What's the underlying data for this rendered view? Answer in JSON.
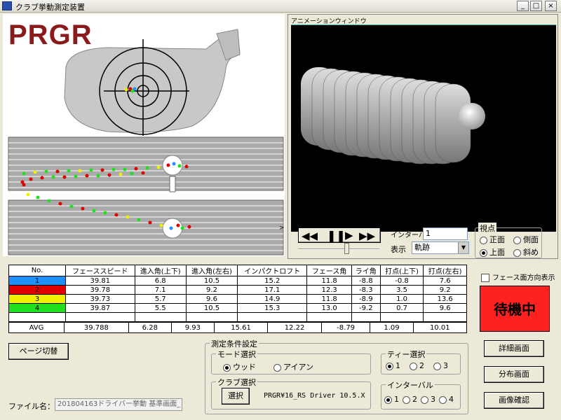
{
  "window": {
    "title": "クラブ挙動測定装置",
    "buttons": [
      "_",
      "□",
      "×"
    ]
  },
  "logo": {
    "text_a": "PR",
    "text_b": "GR"
  },
  "animation_window": {
    "title": "アニメーションウィンドウ"
  },
  "playback": {
    "interval_label": "インターバル",
    "interval_value": "1",
    "display_label": "表示",
    "display_value": "軌跡"
  },
  "viewpoint": {
    "label": "視点",
    "options": [
      {
        "label": "正面",
        "selected": false
      },
      {
        "label": "側面",
        "selected": false
      },
      {
        "label": "上面",
        "selected": true
      },
      {
        "label": "斜め",
        "selected": false
      }
    ]
  },
  "face_direction": {
    "label": "フェース面方向表示"
  },
  "table": {
    "headers": [
      "No.",
      "フェーススピード",
      "進入角(上下)",
      "進入角(左右)",
      "インパクトロフト",
      "フェース角",
      "ライ角",
      "打点(上下)",
      "打点(左右)"
    ],
    "rows": [
      {
        "no": "1",
        "color": "#1e90ff",
        "values": [
          "39.81",
          "6.8",
          "10.5",
          "15.2",
          "11.8",
          "-8.8",
          "-0.8",
          "7.6"
        ]
      },
      {
        "no": "2",
        "color": "#e00000",
        "values": [
          "39.78",
          "7.1",
          "9.2",
          "17.1",
          "12.3",
          "-8.3",
          "3.5",
          "9.2"
        ]
      },
      {
        "no": "3",
        "color": "#f0f000",
        "values": [
          "39.73",
          "5.7",
          "9.6",
          "14.9",
          "11.8",
          "-8.9",
          "1.0",
          "13.6"
        ]
      },
      {
        "no": "4",
        "color": "#20e020",
        "values": [
          "39.87",
          "5.5",
          "10.5",
          "15.3",
          "13.0",
          "-9.2",
          "0.7",
          "9.6"
        ]
      }
    ],
    "avg_label": "AVG",
    "avg_values": [
      "39.788",
      "6.28",
      "9.93",
      "15.61",
      "12.22",
      "-8.79",
      "1.09",
      "10.01"
    ]
  },
  "status": {
    "text": "待機中",
    "color": "#ff2020"
  },
  "page_switch": {
    "label": "ページ切替"
  },
  "file": {
    "label": "ファイル名：",
    "value": "201804163ドライバー挙動 基準画面_"
  },
  "conditions": {
    "title": "測定条件設定",
    "mode": {
      "label": "モード選択",
      "options": [
        {
          "label": "ウッド",
          "selected": true
        },
        {
          "label": "アイアン",
          "selected": false
        }
      ]
    },
    "tee": {
      "label": "ティー選択",
      "options": [
        {
          "label": "1",
          "selected": true
        },
        {
          "label": "2",
          "selected": false
        },
        {
          "label": "3",
          "selected": false
        }
      ]
    },
    "club": {
      "label": "クラブ選択",
      "button": "選択",
      "value": "PRGR¥16_RS Driver 10.5.X"
    },
    "interval": {
      "label": "インターバル",
      "options": [
        {
          "label": "1",
          "selected": true
        },
        {
          "label": "2",
          "selected": false
        },
        {
          "label": "3",
          "selected": false
        },
        {
          "label": "4",
          "selected": false
        }
      ]
    }
  },
  "side_buttons": {
    "detail": "詳細画面",
    "distribution": "分布画面",
    "image_check": "画像確認"
  }
}
